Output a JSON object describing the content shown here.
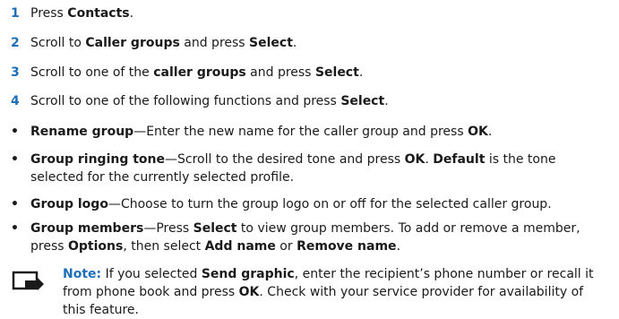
{
  "steps": [
    {
      "num": "1",
      "pre": "Press ",
      "b1": "Contacts",
      "mid": ".",
      "b2": "",
      "post": ""
    },
    {
      "num": "2",
      "pre": "Scroll to ",
      "b1": "Caller groups",
      "mid": " and press ",
      "b2": "Select",
      "post": "."
    },
    {
      "num": "3",
      "pre": "Scroll to one of the ",
      "b1": "caller groups",
      "mid": " and press ",
      "b2": "Select",
      "post": "."
    },
    {
      "num": "4",
      "pre": "Scroll to one of the following functions and press ",
      "b1": "Select",
      "mid": ".",
      "b2": "",
      "post": ""
    }
  ],
  "bullet_symbol": "•",
  "bullets": {
    "rename": {
      "title": "Rename group",
      "t1": "—Enter the new name for the caller group and press ",
      "b1": "OK",
      "t2": "."
    },
    "ringing": {
      "title": "Group ringing tone",
      "t1": "—Scroll to the desired tone and press ",
      "b1": "OK",
      "t2": ". ",
      "b2": "Default",
      "t3": " is the tone selected for the currently selected profile."
    },
    "logo": {
      "title": "Group logo",
      "t1": "—Choose to turn the group logo on or off for the selected caller group."
    },
    "members": {
      "title": "Group members",
      "t1": "—Press ",
      "b1": "Select",
      "t2": " to view group members. To add or remove a member, press ",
      "b2": "Options",
      "t3": ", then select ",
      "b3": "Add name",
      "t4": " or ",
      "b4": "Remove name",
      "t5": "."
    }
  },
  "note": {
    "icon": "note-icon",
    "label": "Note:",
    "t1": " If you selected ",
    "b1": "Send graphic",
    "t2": ", enter the recipient’s phone number or recall it from phone book and press ",
    "b2": "OK",
    "t3": ". Check with your service provider for availability of this feature."
  },
  "colors": {
    "accent": "#1f6fb8",
    "text": "#1a1a1a"
  }
}
